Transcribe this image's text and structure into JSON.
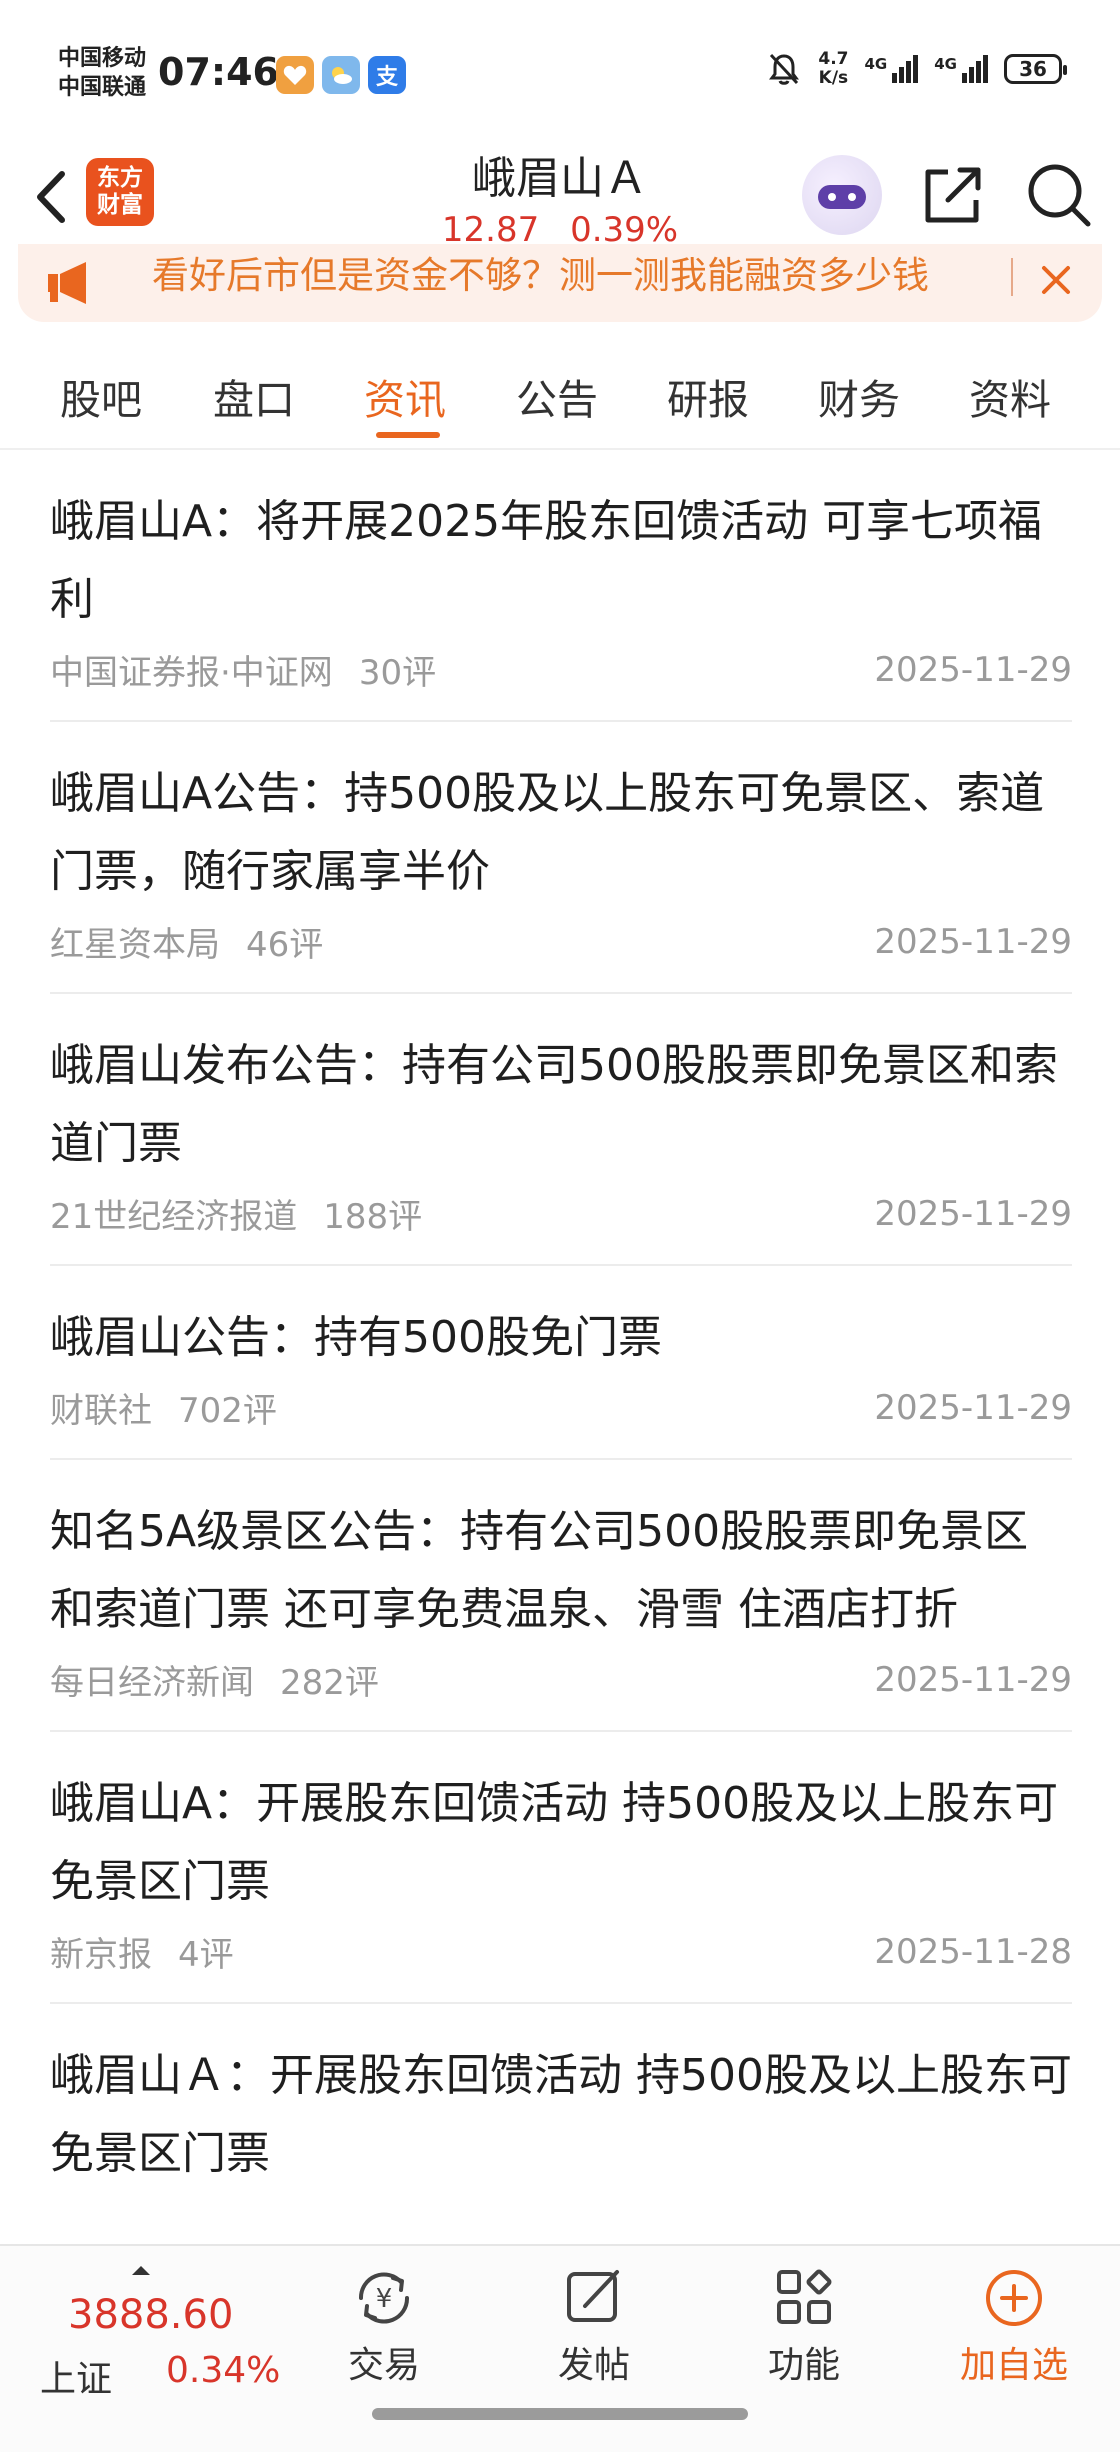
{
  "status_bar": {
    "carrier_1": "中国移动",
    "carrier_2": "中国联通",
    "time": "07:46",
    "app_badges": [
      {
        "icon": "heart-app-icon",
        "color": "#f0a040"
      },
      {
        "icon": "weather-app-icon",
        "color": "#7fb8ec"
      },
      {
        "icon": "alipay-app-icon",
        "color": "#2f7ce8",
        "glyph": "支"
      }
    ],
    "net_speed_value": "4.7",
    "net_speed_unit": "K/s",
    "signal_1_label": "4G",
    "signal_2_label": "4G",
    "battery": "36"
  },
  "header": {
    "logo_line1": "东方",
    "logo_line2": "财富",
    "stock_name": "峨眉山Ａ",
    "price": "12.87",
    "change_pct": "0.39%",
    "accent_color": "#d8352a"
  },
  "promo": {
    "text": "看好后市但是资金不够？测一测我能融资多少钱"
  },
  "tabs": [
    {
      "label": "股吧",
      "active": false
    },
    {
      "label": "盘口",
      "active": false
    },
    {
      "label": "资讯",
      "active": true
    },
    {
      "label": "公告",
      "active": false
    },
    {
      "label": "研报",
      "active": false
    },
    {
      "label": "财务",
      "active": false
    },
    {
      "label": "资料",
      "active": false
    }
  ],
  "news": [
    {
      "title": "峨眉山A：将开展2025年股东回馈活动 可享七项福利",
      "source": "中国证券报·中证网",
      "comments": "30评",
      "date": "2025-11-29"
    },
    {
      "title": "峨眉山A公告：持500股及以上股东可免景区、索道门票，随行家属享半价",
      "source": "红星资本局",
      "comments": "46评",
      "date": "2025-11-29"
    },
    {
      "title": "峨眉山发布公告：持有公司500股股票即免景区和索道门票",
      "source": "21世纪经济报道",
      "comments": "188评",
      "date": "2025-11-29"
    },
    {
      "title": "峨眉山公告：持有500股免门票",
      "source": "财联社",
      "comments": "702评",
      "date": "2025-11-29"
    },
    {
      "title": "知名5A级景区公告：持有公司500股股票即免景区和索道门票 还可享免费温泉、滑雪 住酒店打折",
      "source": "每日经济新闻",
      "comments": "282评",
      "date": "2025-11-29"
    },
    {
      "title": "峨眉山A：开展股东回馈活动 持500股及以上股东可免景区门票",
      "source": "新京报",
      "comments": "4评",
      "date": "2025-11-28"
    },
    {
      "title": "峨眉山Ａ：开展股东回馈活动 持500股及以上股东可免景区门票",
      "source": "",
      "comments": "",
      "date": ""
    }
  ],
  "bottom_bar": {
    "index_value": "3888.60",
    "index_name": "上证",
    "index_change": "0.34%",
    "nav": [
      {
        "label": "交易",
        "icon": "yuan-trade-icon"
      },
      {
        "label": "发帖",
        "icon": "edit-post-icon"
      },
      {
        "label": "功能",
        "icon": "grid-features-icon"
      },
      {
        "label": "加自选",
        "icon": "add-circle-icon"
      }
    ],
    "accent_color": "#e9661f"
  }
}
